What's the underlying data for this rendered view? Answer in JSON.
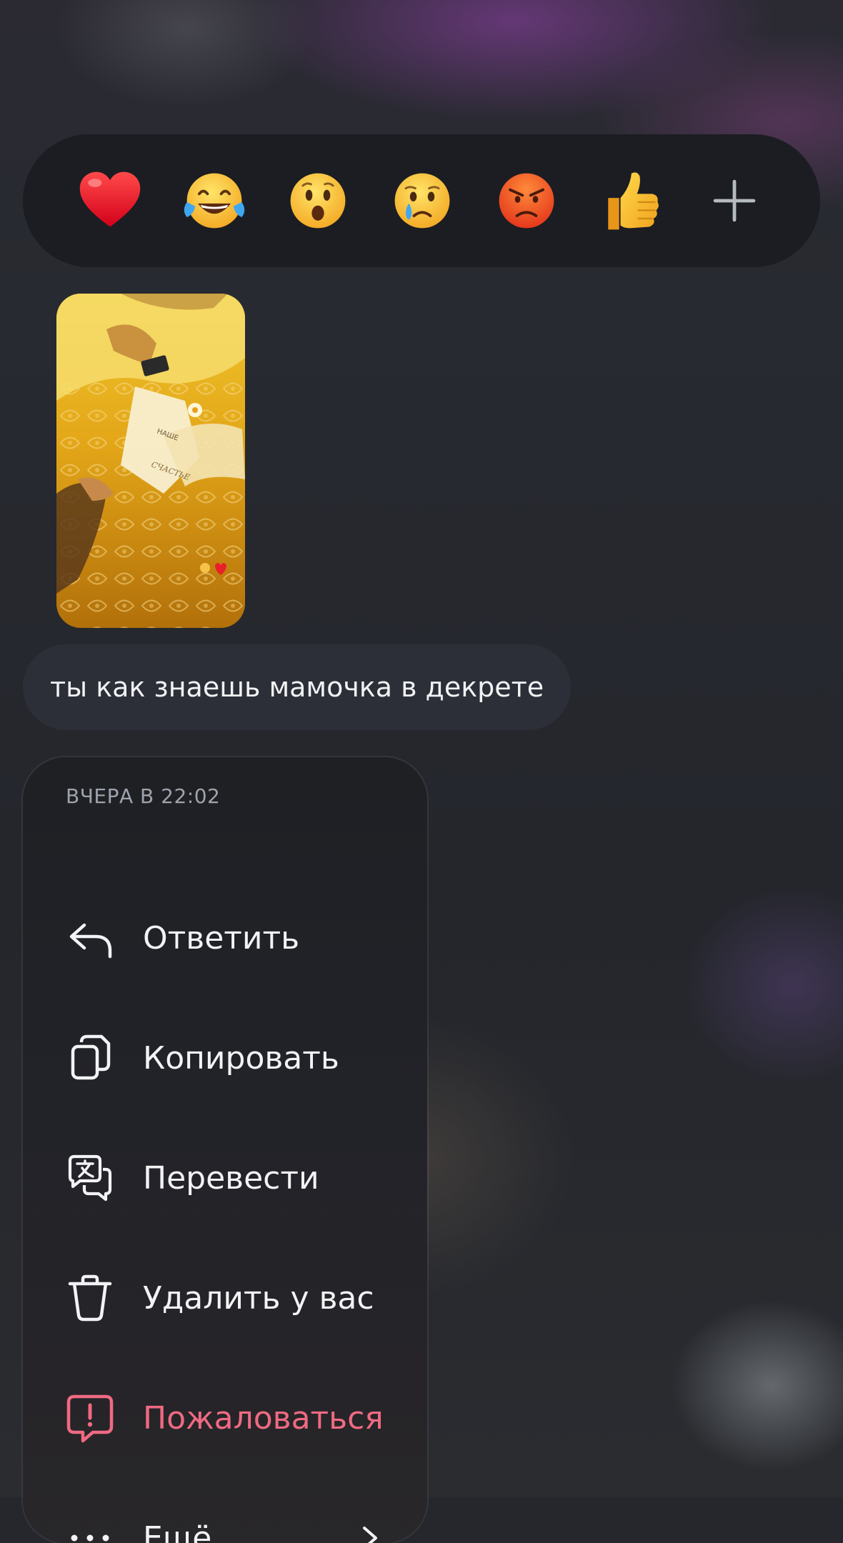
{
  "reactions": [
    {
      "name": "heart-emoji",
      "label": "❤️"
    },
    {
      "name": "laughing-emoji",
      "label": "😂"
    },
    {
      "name": "surprised-emoji",
      "label": "😮"
    },
    {
      "name": "crying-emoji",
      "label": "😢"
    },
    {
      "name": "angry-emoji",
      "label": "😡"
    },
    {
      "name": "thumbs-up-emoji",
      "label": "👍"
    },
    {
      "name": "plus-icon",
      "label": "+"
    }
  ],
  "photo": {
    "page_text": [
      "НАШЕ",
      "СЧАСТЬЕ"
    ]
  },
  "message": {
    "text": "ты как знаешь мамочка в декрете"
  },
  "menu": {
    "timestamp": "ВЧЕРА В 22:02",
    "items": [
      {
        "name": "reply",
        "label": "Ответить",
        "icon": "reply-arrow-icon"
      },
      {
        "name": "copy",
        "label": "Копировать",
        "icon": "copy-icon"
      },
      {
        "name": "translate",
        "label": "Перевести",
        "icon": "translate-icon"
      },
      {
        "name": "delete",
        "label": "Удалить у вас",
        "icon": "trash-icon"
      },
      {
        "name": "report",
        "label": "Пожаловаться",
        "icon": "report-icon"
      },
      {
        "name": "more",
        "label": "Ещё",
        "icon": "more-dots-icon"
      }
    ]
  },
  "colors": {
    "danger": "#ef6a82",
    "text": "#f2f3f5",
    "muted": "#9ea3ac",
    "menu_bg": "#1e2024",
    "bubble_bg": "#2c2f37"
  }
}
